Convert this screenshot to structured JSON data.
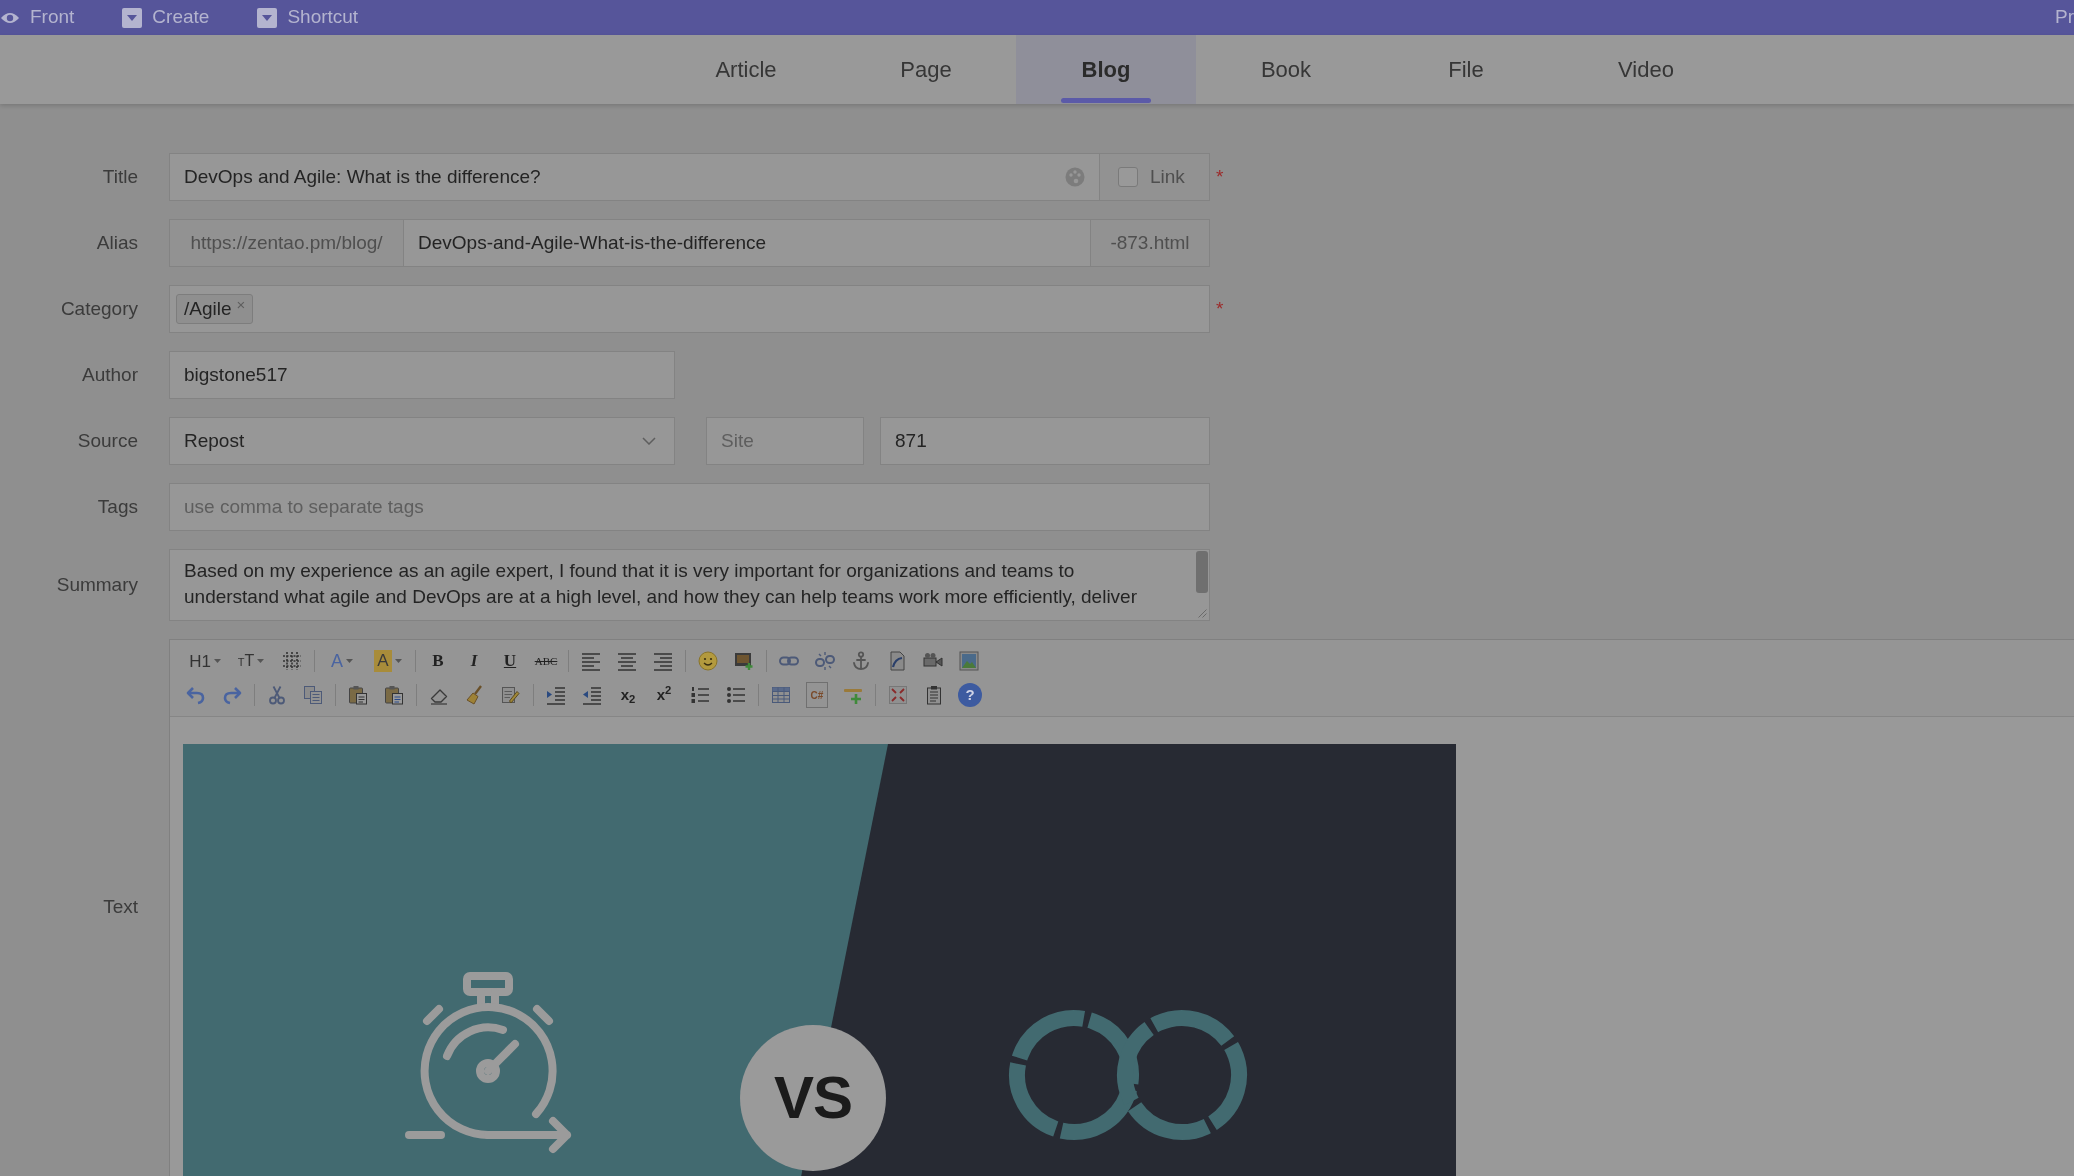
{
  "top_bar": {
    "links": [
      {
        "label": "Front"
      },
      {
        "label": "Create"
      },
      {
        "label": "Shortcut"
      }
    ],
    "right_text": "Pr"
  },
  "tabs": [
    {
      "label": "Article",
      "selected": false
    },
    {
      "label": "Page",
      "selected": false
    },
    {
      "label": "Blog",
      "selected": true
    },
    {
      "label": "Book",
      "selected": false
    },
    {
      "label": "File",
      "selected": false
    },
    {
      "label": "Video",
      "selected": false
    }
  ],
  "form": {
    "fields": [
      {
        "kind": "title",
        "label": "Title",
        "value": "DevOps and Agile: What is the difference?",
        "link": {
          "label": "Link",
          "checked": false
        },
        "required_mark": "*"
      },
      {
        "kind": "alias",
        "label": "Alias",
        "prefix": "https://zentao.pm/blog/",
        "value": "DevOps-and-Agile-What-is-the-difference",
        "suffix": "-873.html"
      },
      {
        "kind": "chips",
        "label": "Category",
        "chips": [
          {
            "label": "/Agile",
            "remove": "×"
          }
        ],
        "required_mark": "*"
      },
      {
        "kind": "short-text",
        "label": "Author",
        "value": "bigstone517"
      },
      {
        "kind": "source",
        "label": "Source",
        "value": "Repost",
        "site": {
          "placeholder": "Site"
        },
        "field_3": {
          "value": "871"
        }
      },
      {
        "kind": "text",
        "label": "Tags",
        "placeholder": "use comma to separate tags"
      },
      {
        "kind": "textarea",
        "label": "Summary",
        "lines": [
          "Based on my experience as an agile expert, I found that it is very important for organizations and teams to",
          "understand what agile and DevOps are at a high level, and how they can help teams work more efficiently, deliver"
        ]
      }
    ]
  },
  "editor": {
    "label": "Text",
    "toolbar": {
      "rows": [
        [
          [
            {
              "kind": "heading",
              "text": "H1",
              "dropdown": true
            },
            {
              "kind": "font-size",
              "text": "TT",
              "dropdown": true
            },
            {
              "kind": "line-spacing"
            }
          ],
          [
            {
              "kind": "font-color",
              "text": "A",
              "dropdown": true
            },
            {
              "kind": "highlight",
              "text": "A",
              "dropdown": true
            }
          ],
          [
            {
              "kind": "bold",
              "text": "B"
            },
            {
              "kind": "italic",
              "text": "I"
            },
            {
              "kind": "underline",
              "text": "U"
            },
            {
              "kind": "strikethrough",
              "text": "ABC"
            }
          ],
          [
            {
              "kind": "align-left"
            },
            {
              "kind": "align-center"
            },
            {
              "kind": "align-right"
            }
          ],
          [
            {
              "kind": "smiley"
            },
            {
              "kind": "image-plus"
            }
          ],
          [
            {
              "kind": "link"
            },
            {
              "kind": "unlink"
            },
            {
              "kind": "anchor"
            },
            {
              "kind": "swoosh-document"
            },
            {
              "kind": "video-camera"
            },
            {
              "kind": "picture"
            }
          ]
        ],
        [
          [
            {
              "kind": "undo"
            },
            {
              "kind": "redo"
            }
          ],
          [
            {
              "kind": "scissors"
            },
            {
              "kind": "copy"
            }
          ],
          [
            {
              "kind": "paste-text"
            },
            {
              "kind": "paste-word"
            }
          ],
          [
            {
              "kind": "eraser"
            },
            {
              "kind": "brush"
            },
            {
              "kind": "document-pencil"
            }
          ],
          [
            {
              "kind": "indent"
            },
            {
              "kind": "outdent"
            },
            {
              "kind": "subscript",
              "text": "x$_{2}$"
            },
            {
              "kind": "superscript",
              "text": "x$^{2}$"
            },
            {
              "kind": "numbered-list"
            },
            {
              "kind": "bullet-list"
            }
          ],
          [
            {
              "kind": "table"
            },
            {
              "kind": "code",
              "text": "C#"
            },
            {
              "kind": "rule-plus"
            }
          ],
          [
            {
              "kind": "fullscreen"
            },
            {
              "kind": "clipboard"
            },
            {
              "kind": "help",
              "text": "?"
            }
          ]
        ]
      ]
    },
    "content": {
      "kind": "banner",
      "badge": "VS"
    }
  }
}
